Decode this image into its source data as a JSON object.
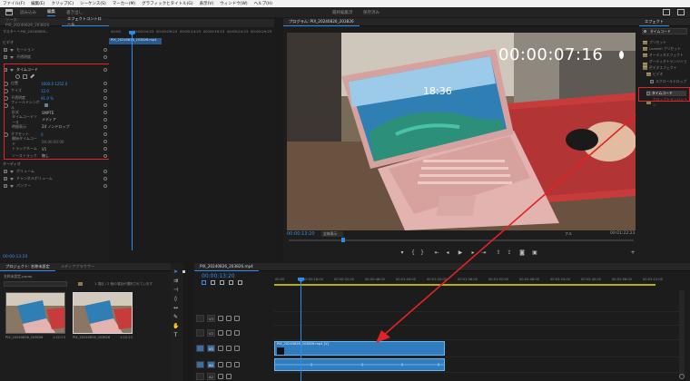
{
  "menu": {
    "items": [
      "ファイル(F)",
      "編集(E)",
      "クリップ(C)",
      "シーケンス(S)",
      "マーカー(M)",
      "グラフィックとタイトル(G)",
      "表示(V)",
      "ウィンドウ(W)",
      "ヘルプ(H)"
    ]
  },
  "workspace": {
    "tabs": [
      "読み込み",
      "編集",
      "書き出し"
    ],
    "active_tab": "編集",
    "center_title": "最終編集済",
    "center_subtitle": "保存済み"
  },
  "effects_panel": {
    "tabs": [
      "ソース: PIX_20240826_203826.",
      "エフェクトコントロール",
      "オーディオクリップ"
    ],
    "source_label": "マスター * PIX_20240826...",
    "clip_label": "PIX_20240826_20",
    "video_section": "ビデオ",
    "motion_label": "モーション",
    "opacity_label": "不透明度",
    "timecode_fx": "タイムコード",
    "props": [
      {
        "label": "位置",
        "value": "1600.0    1252.0"
      },
      {
        "label": "サイズ",
        "value": "12.0"
      },
      {
        "label": "不透明度",
        "value": "91.0 %"
      },
      {
        "label": "フィールドシンボル",
        "value": ""
      },
      {
        "label": "形式",
        "value": "SMPTE"
      },
      {
        "label": "タイムコードソース",
        "value": "メディア"
      },
      {
        "label": "時間表示",
        "value": "24 ノンドロップ"
      },
      {
        "label": "オフセット",
        "value": "0"
      },
      {
        "label": "開始タイムコード",
        "value": "00:00:00:00"
      },
      {
        "label": "トラックネーム",
        "value": "V1"
      },
      {
        "label": "ソーストラック",
        "value": "無し"
      }
    ],
    "audio_section": "オーディオ",
    "audio_items": [
      "ボリューム",
      "チャンネルボリューム",
      "パンナー"
    ],
    "bottom_tc": "00:00:13:20"
  },
  "ec_timeline": {
    "ruler": [
      "00:00",
      "00:00:04:23",
      "00:00:09:23",
      "00:00:14:23",
      "00:00:19:23",
      "00:00:24:23",
      "00:00:29:23"
    ],
    "clip_label": "PIX_20240826_203826.mp4"
  },
  "program": {
    "title": "プログラム: PIX_20240826_203826",
    "overlay_timecode": "00:00:07:16",
    "current_tc": "00:00:13:20",
    "fit": "全体表示",
    "quality": "フル",
    "duration_tc": "00:01:22:23"
  },
  "effects_right": {
    "title": "エフェクト",
    "search_placeholder": "タイムコード",
    "items": [
      {
        "label": "プリセット",
        "indent": 1
      },
      {
        "label": "Lumetri プリセット",
        "indent": 1
      },
      {
        "label": "オーディオエフェクト",
        "indent": 1
      },
      {
        "label": "オーディオトランジション",
        "indent": 1
      },
      {
        "label": "ビデオエフェクト",
        "indent": 1
      },
      {
        "label": "ビデオ",
        "indent": 2
      },
      {
        "label": "スクロールテロップ",
        "indent": 3
      },
      {
        "label": "タイムコード",
        "indent": 3
      },
      {
        "label": "クロップトランジション",
        "indent": 2
      }
    ]
  },
  "project": {
    "tabs": [
      "プロジェクト: 名称未設定",
      "メディアブラウザー"
    ],
    "project_name": "名称未設定.prproj",
    "info": "1 項目 / 2 個の項目が選択されています",
    "thumbs": [
      {
        "caption": "PIX_20240826_203826",
        "duration": "1:22:23"
      },
      {
        "caption": "PIX_20240826_203826",
        "duration": "1:22:23"
      }
    ]
  },
  "timeline": {
    "tab": "PIX_20240826_203826.mp4",
    "timecode": "00:00:13:20",
    "ruler": [
      "00:00",
      "00:00:16:00",
      "00:00:32:00",
      "00:00:48:00",
      "00:01:04:00",
      "00:01:20:00",
      "00:01:36:00",
      "00:01:52:00",
      "00:02:08:00",
      "00:02:24:00",
      "00:02:40:00",
      "00:02:56:00",
      "00:03:12:00"
    ],
    "tracks": [
      "V3",
      "V2",
      "V1",
      "A1",
      "A2"
    ],
    "video_clip_label": "PIX_20240826_203826.mp4 [V]"
  },
  "colors": {
    "accent": "#2d8ceb",
    "highlight_box": "#e02424",
    "clip": "#2f7dbf"
  }
}
